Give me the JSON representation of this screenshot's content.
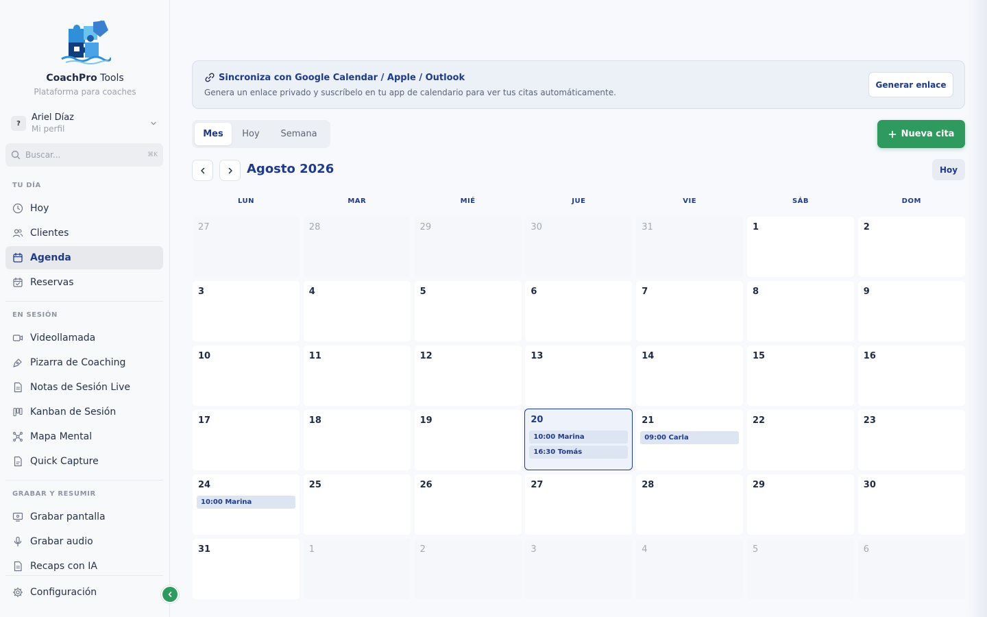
{
  "brand": {
    "name_bold": "CoachPro",
    "name_rest": " Tools",
    "subtitle": "Plataforma para coaches"
  },
  "profile": {
    "initial": "?",
    "name": "Ariel Díaz",
    "subtitle": "Mi perfil"
  },
  "search": {
    "placeholder": "Buscar...",
    "shortcut": "⌘K"
  },
  "sidebar": {
    "sections": {
      "tu_dia": "TU DÍA",
      "en_sesion": "EN SESIÓN",
      "grabar": "GRABAR Y RESUMIR"
    },
    "items": {
      "hoy": "Hoy",
      "clientes": "Clientes",
      "agenda": "Agenda",
      "reservas": "Reservas",
      "videollamada": "Videollamada",
      "pizarra": "Pizarra de Coaching",
      "notas": "Notas de Sesión Live",
      "kanban": "Kanban de Sesión",
      "mapa": "Mapa Mental",
      "quick": "Quick Capture",
      "grabar_pantalla": "Grabar pantalla",
      "grabar_audio": "Grabar audio",
      "recaps": "Recaps con IA",
      "config": "Configuración"
    },
    "active": "agenda"
  },
  "sync": {
    "title": "Sincroniza con Google Calendar / Apple / Outlook",
    "description": "Genera un enlace privado y suscríbelo en tu app de calendario para ver tus citas automáticamente.",
    "button": "Generar enlace"
  },
  "view_tabs": {
    "mes": "Mes",
    "hoy": "Hoy",
    "semana": "Semana",
    "active": "mes"
  },
  "new_button": "Nueva cita",
  "calendar": {
    "title": "Agosto 2026",
    "today_button": "Hoy",
    "weekdays": [
      "LUN",
      "MAR",
      "MIÉ",
      "JUE",
      "VIE",
      "SÁB",
      "DOM"
    ],
    "weeks": [
      [
        {
          "d": "27",
          "o": true
        },
        {
          "d": "28",
          "o": true
        },
        {
          "d": "29",
          "o": true
        },
        {
          "d": "30",
          "o": true
        },
        {
          "d": "31",
          "o": true
        },
        {
          "d": "1"
        },
        {
          "d": "2"
        }
      ],
      [
        {
          "d": "3"
        },
        {
          "d": "4"
        },
        {
          "d": "5"
        },
        {
          "d": "6"
        },
        {
          "d": "7"
        },
        {
          "d": "8"
        },
        {
          "d": "9"
        }
      ],
      [
        {
          "d": "10"
        },
        {
          "d": "11"
        },
        {
          "d": "12"
        },
        {
          "d": "13"
        },
        {
          "d": "14"
        },
        {
          "d": "15"
        },
        {
          "d": "16"
        }
      ],
      [
        {
          "d": "17"
        },
        {
          "d": "18"
        },
        {
          "d": "19"
        },
        {
          "d": "20",
          "today": true,
          "events": [
            "10:00 Marina",
            "16:30 Tomás"
          ]
        },
        {
          "d": "21",
          "events": [
            "09:00 Carla"
          ]
        },
        {
          "d": "22"
        },
        {
          "d": "23"
        }
      ],
      [
        {
          "d": "24",
          "events": [
            "10:00 Marina"
          ]
        },
        {
          "d": "25"
        },
        {
          "d": "26"
        },
        {
          "d": "27"
        },
        {
          "d": "28"
        },
        {
          "d": "29"
        },
        {
          "d": "30"
        }
      ],
      [
        {
          "d": "31"
        },
        {
          "d": "1",
          "o": true
        },
        {
          "d": "2",
          "o": true
        },
        {
          "d": "3",
          "o": true
        },
        {
          "d": "4",
          "o": true
        },
        {
          "d": "5",
          "o": true
        },
        {
          "d": "6",
          "o": true
        }
      ]
    ]
  },
  "colors": {
    "primary": "#1e3a8a",
    "accent_green": "#2e9a5e",
    "event_bg": "#dde5f3"
  }
}
